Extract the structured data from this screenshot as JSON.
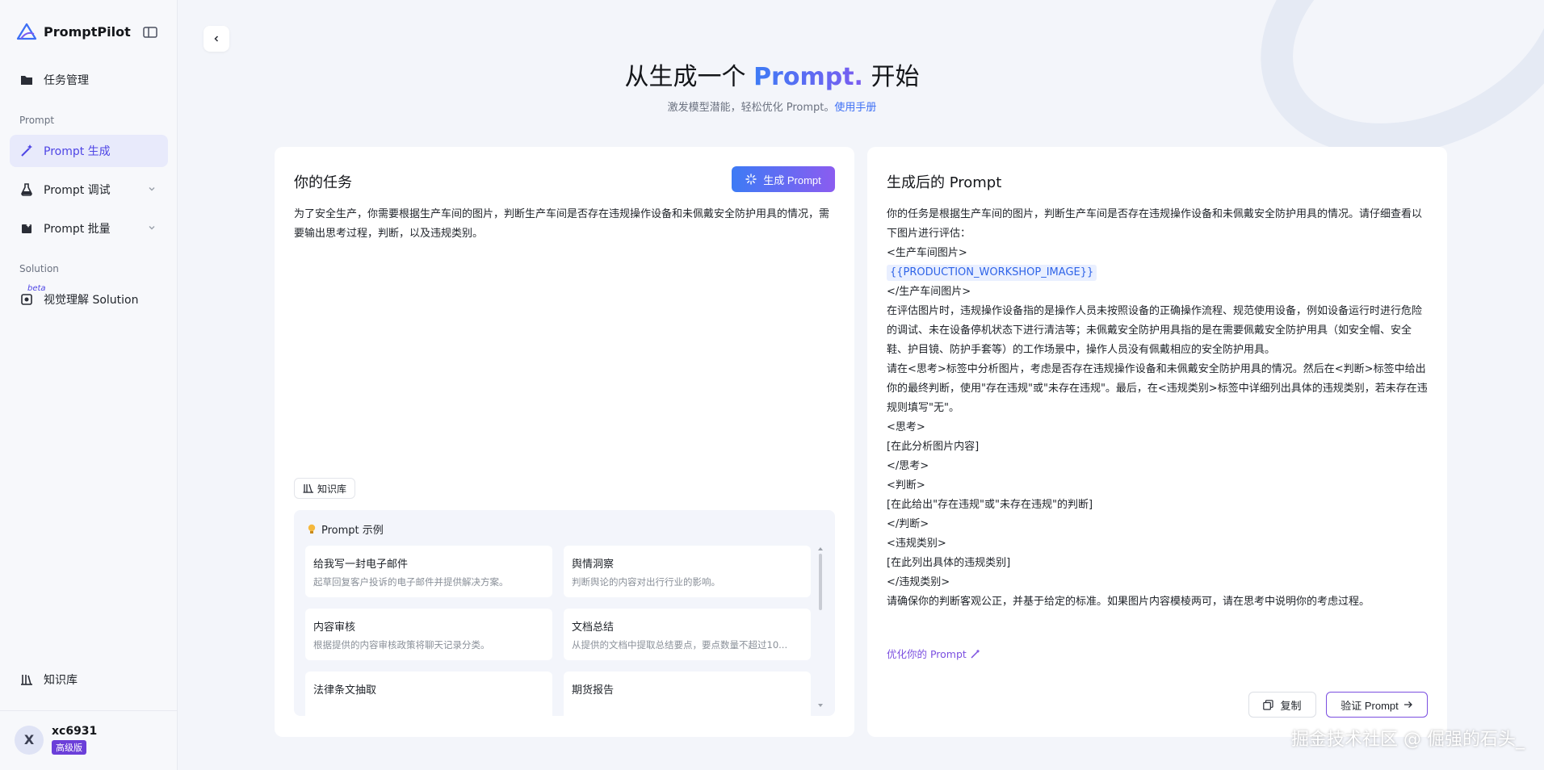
{
  "brand": {
    "name": "PromptPilot"
  },
  "sidebar": {
    "items": [
      {
        "label": "任务管理"
      },
      {
        "label": "Prompt 生成"
      },
      {
        "label": "Prompt 调试"
      },
      {
        "label": "Prompt 批量"
      },
      {
        "label": "视觉理解 Solution"
      }
    ],
    "sections": {
      "prompt": "Prompt",
      "solution": "Solution"
    },
    "beta": "beta",
    "knowledge_base": "知识库"
  },
  "user": {
    "initial": "X",
    "name": "xc6931",
    "badge": "高级版"
  },
  "hero": {
    "title_prefix": "从生成一个",
    "title_accent": "Prompt.",
    "title_suffix": "开始",
    "subtitle": "激发模型潜能，轻松优化 Prompt。",
    "manual_link": "使用手册"
  },
  "task": {
    "title": "你的任务",
    "generate_button": "生成 Prompt",
    "text": "为了安全生产，你需要根据生产车间的图片，判断生产车间是否存在违规操作设备和未佩戴安全防护用具的情况，需要输出思考过程，判断，以及违规类别。",
    "knowledge_chip": "知识库"
  },
  "examples": {
    "title": "Prompt 示例",
    "items": [
      {
        "title": "给我写一封电子邮件",
        "desc": "起草回复客户投诉的电子邮件并提供解决方案。"
      },
      {
        "title": "舆情洞察",
        "desc": "判断舆论的内容对出行行业的影响。"
      },
      {
        "title": "内容审核",
        "desc": "根据提供的内容审核政策将聊天记录分类。"
      },
      {
        "title": "文档总结",
        "desc": "从提供的文档中提取总结要点，要点数量不超过10..."
      },
      {
        "title": "法律条文抽取",
        "desc": ""
      },
      {
        "title": "期货报告",
        "desc": ""
      }
    ]
  },
  "output": {
    "title": "生成后的 Prompt",
    "lines": [
      "你的任务是根据生产车间的图片，判断生产车间是否存在违规操作设备和未佩戴安全防护用具的情况。请仔细查看以下图片进行评估：",
      "<生产车间图片>",
      "{{PRODUCTION_WORKSHOP_IMAGE}}",
      "</生产车间图片>",
      "在评估图片时，违规操作设备指的是操作人员未按照设备的正确操作流程、规范使用设备，例如设备运行时进行危险的调试、未在设备停机状态下进行清洁等；未佩戴安全防护用具指的是在需要佩戴安全防护用具（如安全帽、安全鞋、护目镜、防护手套等）的工作场景中，操作人员没有佩戴相应的安全防护用具。",
      "请在<思考>标签中分析图片，考虑是否存在违规操作设备和未佩戴安全防护用具的情况。然后在<判断>标签中给出你的最终判断，使用\"存在违规\"或\"未存在违规\"。最后，在<违规类别>标签中详细列出具体的违规类别，若未存在违规则填写\"无\"。",
      "<思考>",
      "[在此分析图片内容]",
      "</思考>",
      "<判断>",
      "[在此给出\"存在违规\"或\"未存在违规\"的判断]",
      "</判断>",
      "<违规类别>",
      "[在此列出具体的违规类别]",
      "</违规类别>",
      "请确保你的判断客观公正，并基于给定的标准。如果图片内容模棱两可，请在思考中说明你的考虑过程。"
    ],
    "optimize_link": "优化你的 Prompt",
    "copy_button": "复制",
    "verify_button": "验证 Prompt"
  },
  "watermark": "掘金技术社区 @ 倔强的石头_"
}
